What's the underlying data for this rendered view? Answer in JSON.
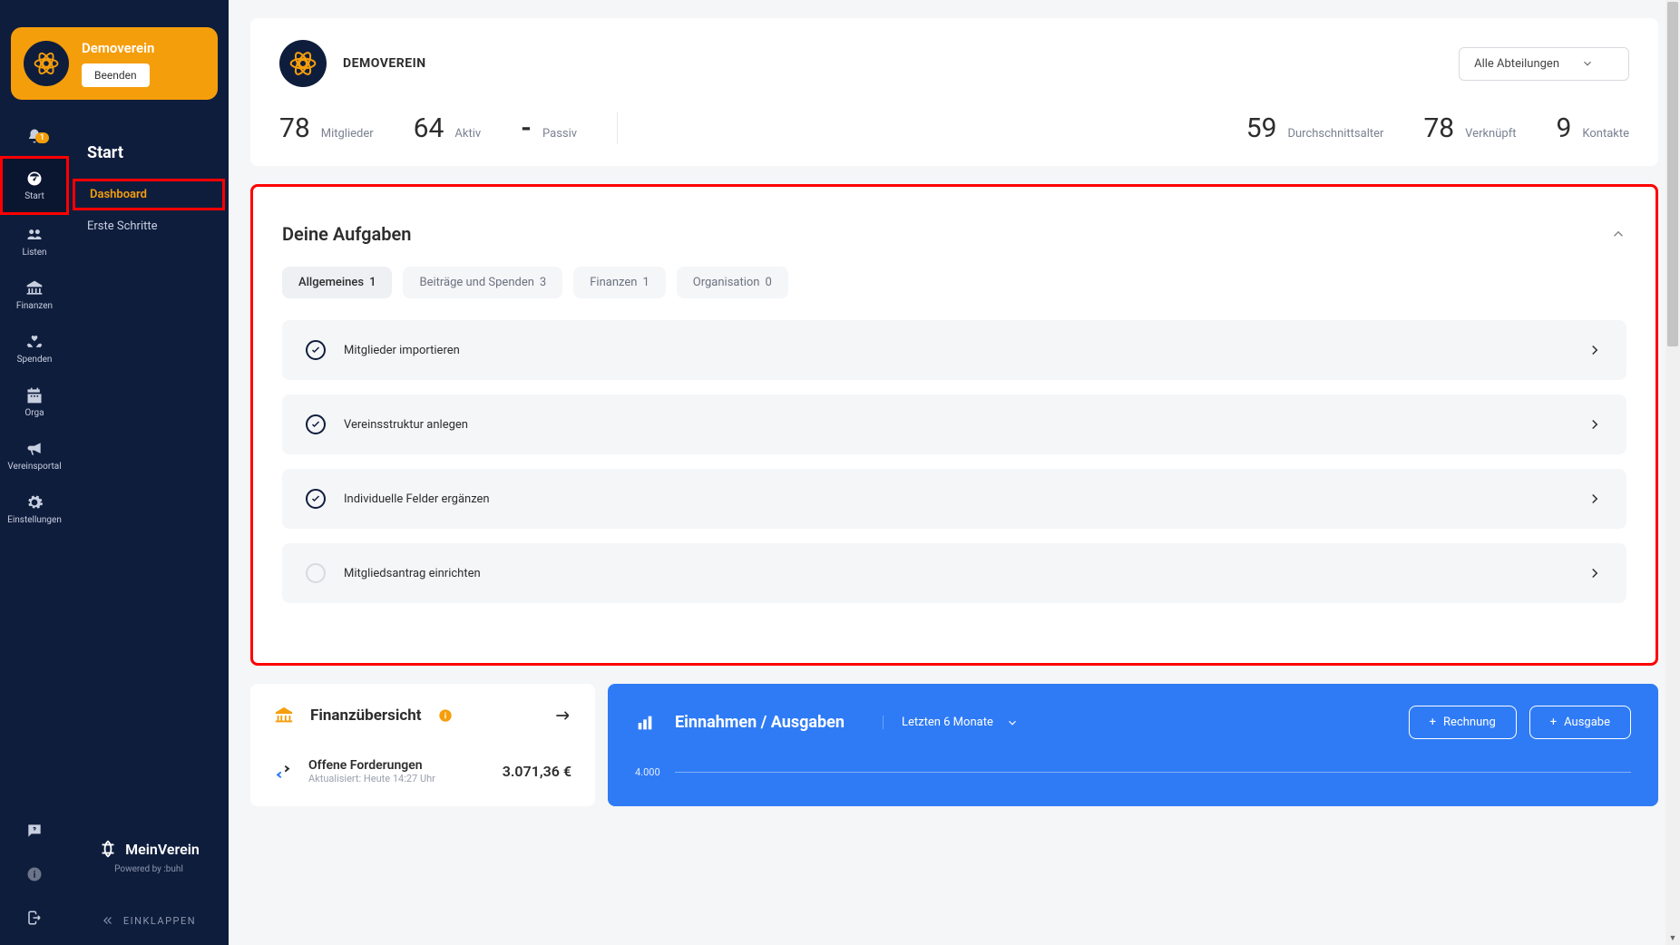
{
  "org": {
    "name": "Demoverein",
    "name_upper": "DEMOVEREIN",
    "end_btn": "Beenden",
    "dept_select": "Alle Abteilungen"
  },
  "notifications_badge": "1",
  "nav_rail": {
    "start": "Start",
    "listen": "Listen",
    "finanzen": "Finanzen",
    "spenden": "Spenden",
    "orga": "Orga",
    "vereinsportal": "Vereinsportal",
    "einstellungen": "Einstellungen"
  },
  "nav_secondary": {
    "title": "Start",
    "dashboard": "Dashboard",
    "erste_schritte": "Erste Schritte",
    "logo": "MeinVerein",
    "powered": "Powered by :buhl",
    "collapse": "EINKLAPPEN"
  },
  "stats": {
    "mitglieder_n": "78",
    "mitglieder_l": "Mitglieder",
    "aktiv_n": "64",
    "aktiv_l": "Aktiv",
    "passiv_n": "-",
    "passiv_l": "Passiv",
    "alter_n": "59",
    "alter_l": "Durchschnittsalter",
    "verknuepft_n": "78",
    "verknuepft_l": "Verknüpft",
    "kontakte_n": "9",
    "kontakte_l": "Kontakte"
  },
  "tasks": {
    "title": "Deine Aufgaben",
    "tabs": [
      {
        "label": "Allgemeines",
        "count": "1"
      },
      {
        "label": "Beiträge und Spenden",
        "count": "3"
      },
      {
        "label": "Finanzen",
        "count": "1"
      },
      {
        "label": "Organisation",
        "count": "0"
      }
    ],
    "items": [
      {
        "label": "Mitglieder importieren",
        "done": true
      },
      {
        "label": "Vereinsstruktur anlegen",
        "done": true
      },
      {
        "label": "Individuelle Felder ergänzen",
        "done": true
      },
      {
        "label": "Mitgliedsantrag einrichten",
        "done": false
      }
    ]
  },
  "finance": {
    "left": {
      "title": "Finanzübersicht",
      "sub_title": "Offene Forderungen",
      "sub_updated": "Aktualisiert: Heute 14:27 Uhr",
      "amount": "3.071,36 €"
    },
    "right": {
      "title": "Einnahmen / Ausgaben",
      "period": "Letzten 6 Monate",
      "btn_rechnung": "Rechnung",
      "btn_ausgabe": "Ausgabe",
      "y_tick": "4.000"
    }
  }
}
